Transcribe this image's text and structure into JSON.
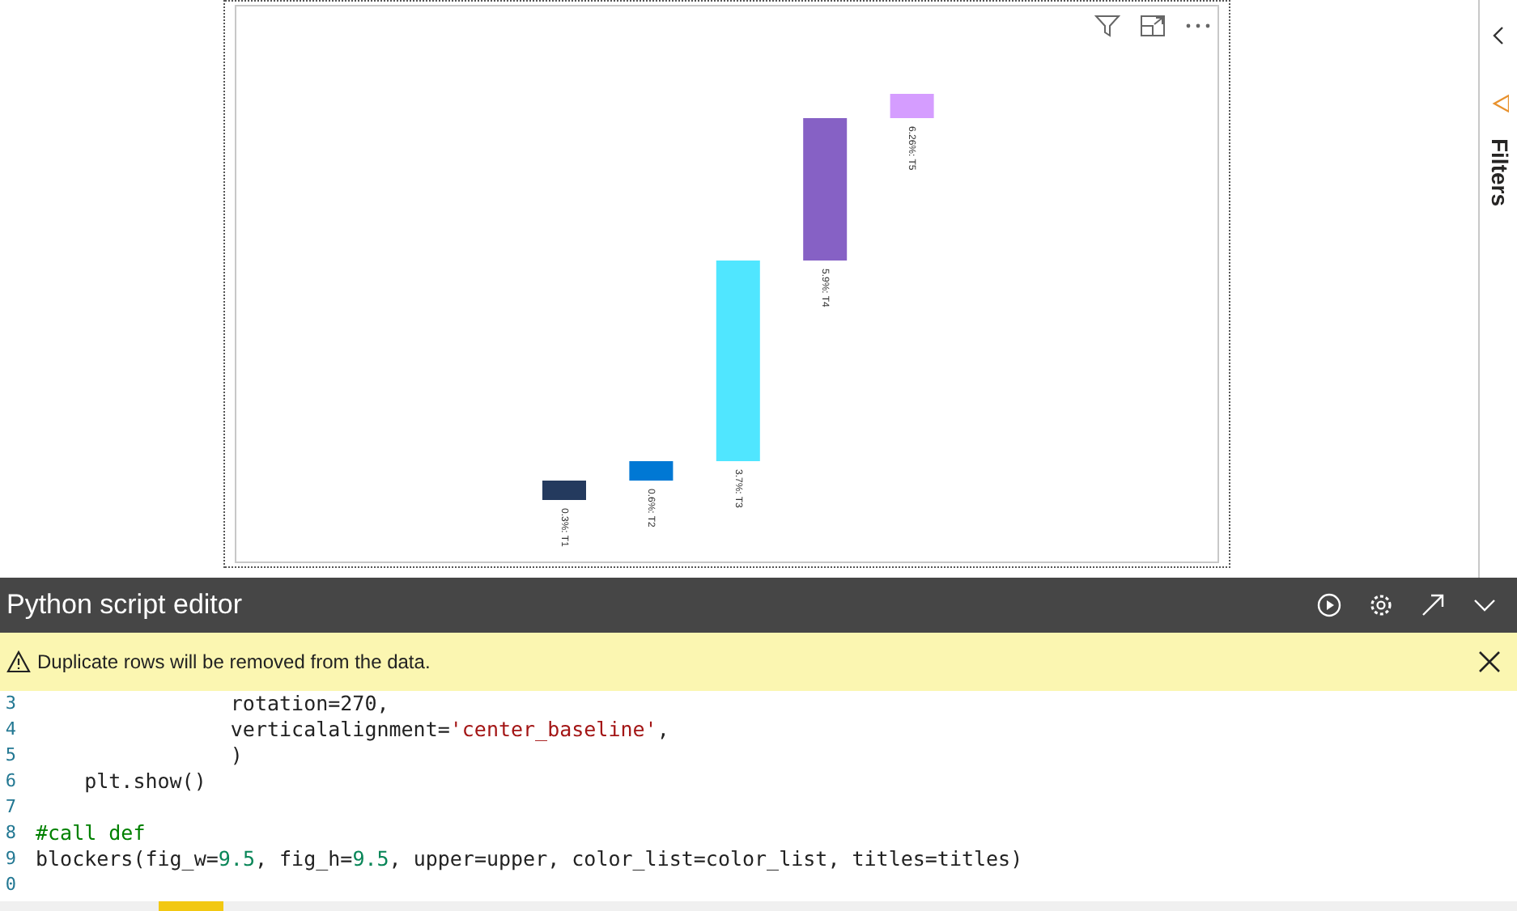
{
  "visual": {
    "bars": [
      {
        "label": "0.3%: T1",
        "color": "#243a5e"
      },
      {
        "label": "0.6%: T2",
        "color": "#0078d4"
      },
      {
        "label": "3.7%: T3",
        "color": "#50e6ff"
      },
      {
        "label": "5.9%: T4",
        "color": "#8661c5"
      },
      {
        "label": "6.26%: T5",
        "color": "#d59dff"
      }
    ]
  },
  "filters_pane": {
    "title": "Filters"
  },
  "editor": {
    "title": "Python script editor",
    "warning": "Duplicate rows will be removed from the data.",
    "lines": [
      {
        "number": "3",
        "tokens": [
          {
            "kind": "plain",
            "text": "                rotation=270,"
          }
        ]
      },
      {
        "number": "4",
        "tokens": [
          {
            "kind": "plain",
            "text": "                verticalalignment="
          },
          {
            "kind": "string",
            "text": "'center_baseline'"
          },
          {
            "kind": "plain",
            "text": ","
          }
        ]
      },
      {
        "number": "5",
        "tokens": [
          {
            "kind": "plain",
            "text": "                )"
          }
        ]
      },
      {
        "number": "6",
        "tokens": [
          {
            "kind": "plain",
            "text": "    plt.show()"
          }
        ]
      },
      {
        "number": "7"
      },
      {
        "number": "8",
        "tokens": [
          {
            "kind": "comment",
            "text": "#call def"
          }
        ]
      },
      {
        "number": "9",
        "tokens": [
          {
            "kind": "plain",
            "text": "blockers(fig_w="
          },
          {
            "kind": "number",
            "text": "9.5"
          },
          {
            "kind": "plain",
            "text": ", fig_h="
          },
          {
            "kind": "number",
            "text": "9.5"
          },
          {
            "kind": "plain",
            "text": ", upper=upper, color_list=color_list, titles=titles)"
          }
        ]
      },
      {
        "number": "0"
      }
    ]
  }
}
